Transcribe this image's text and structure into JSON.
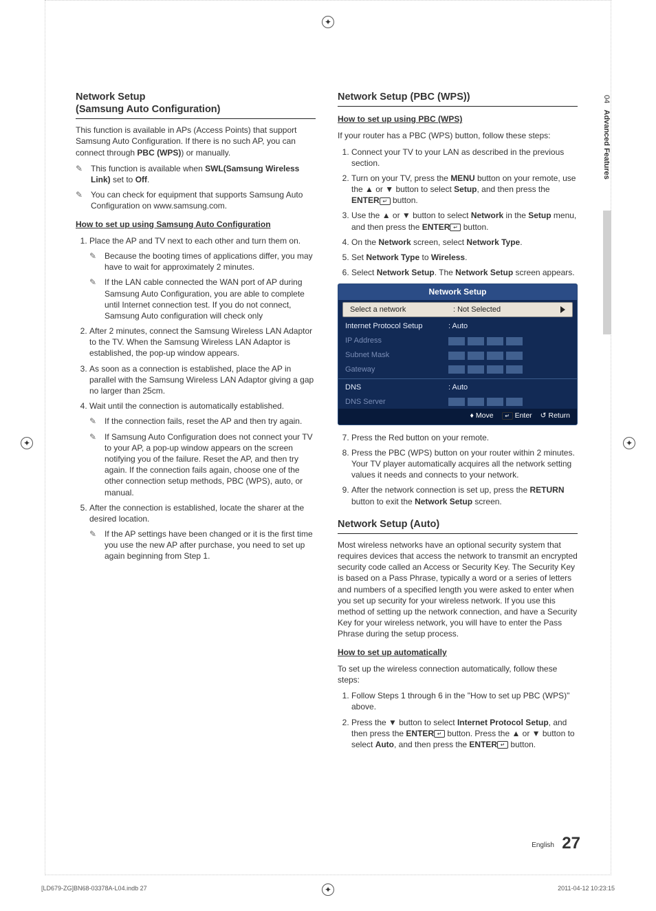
{
  "side_tab": {
    "num": "04",
    "label": "Advanced Features"
  },
  "left": {
    "h": "Network Setup\n(Samsung Auto Configuration)",
    "intro": "This function is available in APs (Access Points) that support Samsung Auto Configuration. If there is no such AP, you can connect through PBC (WPS) or manually.",
    "intro_bold1": "PBC (WPS)",
    "note1_pre": "This function is available when ",
    "note1_bold": "SWL(Samsung Wireless Link)",
    "note1_post": " set to ",
    "note1_off": "Off",
    "note2": "You can check for equipment that supports Samsung Auto Configuration on www.samsung.com.",
    "subh": "How to set up using Samsung Auto Configuration",
    "s1": "Place the AP and TV next to each other and turn them on.",
    "s1n1": "Because the booting times of applications differ, you may have to wait for approximately 2 minutes.",
    "s1n2": "If the LAN cable connected the WAN port of AP during Samsung Auto Configuration, you are able to complete until Internet connection test. If you do not connect, Samsung Auto configuration will check only",
    "s2": "After 2 minutes, connect the Samsung Wireless LAN Adaptor to the TV. When the Samsung Wireless LAN Adaptor is established, the pop-up window appears.",
    "s3": "As soon as a connection is established, place the AP in parallel with the Samsung Wireless LAN Adaptor giving a gap no larger than 25cm.",
    "s4": "Wait until the connection is automatically established.",
    "s4n1": "If the connection fails, reset the AP and then try again.",
    "s4n2": "If Samsung Auto Configuration does not connect your TV to your AP, a pop-up window appears on the screen notifying you of the failure. Reset the AP, and then try again. If the connection fails again, choose one of the other connection setup methods, PBC (WPS), auto, or manual.",
    "s5": "After the connection is established, locate the sharer at the desired location.",
    "s5n1": "If the AP settings have been changed or it is the first time you use the new AP after purchase, you need to set up again beginning from Step 1."
  },
  "right_a": {
    "h": "Network Setup (PBC (WPS))",
    "subh": "How to set up using PBC (WPS)",
    "intro": "If your router has a PBC (WPS) button, follow these steps:",
    "s1": "Connect your TV to your LAN as described in the previous section.",
    "s2_a": "Turn on your TV, press the ",
    "s2_menu": "MENU",
    "s2_b": " button on your remote, use the ▲ or ▼ button to select ",
    "s2_setup": "Setup",
    "s2_c": ", and then press the ",
    "s2_enter": "ENTER",
    "s2_d": " button.",
    "s3_a": "Use the ▲ or ▼ button to select ",
    "s3_net": "Network",
    "s3_b": " in the ",
    "s3_setup": "Setup",
    "s3_c": " menu, and then press the ",
    "s3_enter": "ENTER",
    "s3_d": " button.",
    "s4_a": "On the ",
    "s4_net": "Network",
    "s4_b": " screen, select ",
    "s4_nt": "Network Type",
    "s4_c": ".",
    "s5_a": "Set ",
    "s5_nt": "Network Type",
    "s5_b": " to ",
    "s5_w": "Wireless",
    "s5_c": ".",
    "s6_a": "Select ",
    "s6_ns": "Network Setup",
    "s6_b": ". The ",
    "s6_ns2": "Network Setup",
    "s6_c": " screen appears.",
    "panel": {
      "title": "Network Setup",
      "row_sel_lab": "Select a network",
      "row_sel_val": ": Not Selected",
      "row_ips_lab": "Internet Protocol Setup",
      "row_ips_val": ": Auto",
      "row_ip": "IP Address",
      "row_sn": "Subnet Mask",
      "row_gw": "Gateway",
      "row_dns_lab": "DNS",
      "row_dns_val": ": Auto",
      "row_ds": "DNS Server",
      "f_move": "Move",
      "f_enter": "Enter",
      "f_return": "Return"
    },
    "s7": "Press the Red button on your remote.",
    "s8": "Press the PBC (WPS) button on your router within 2 minutes. Your TV player automatically acquires all the network setting values it needs and connects to your network.",
    "s9_a": "After the network connection is set up, press the ",
    "s9_ret": "RETURN",
    "s9_b": " button to exit the ",
    "s9_ns": "Network Setup",
    "s9_c": " screen."
  },
  "right_b": {
    "h": "Network Setup (Auto)",
    "intro": "Most wireless networks have an optional security system that requires devices that access the network to transmit an encrypted security code called an Access or Security Key. The Security Key is based on a Pass Phrase, typically a word or a series of letters and numbers of a specified length you were asked to enter when you set up security for your wireless network. If you use this method of setting up the network connection, and have a Security Key for your wireless network, you will have to enter the Pass Phrase during the setup process.",
    "subh": "How to set up automatically",
    "lead": "To set up the wireless connection automatically, follow these steps:",
    "s1": "Follow Steps 1 through 6 in the \"How to set up PBC (WPS)\" above.",
    "s2_a": "Press the ▼ button to select ",
    "s2_ips": "Internet Protocol Setup",
    "s2_b": ", and then press the ",
    "s2_enter": "ENTER",
    "s2_c": " button. Press the ▲ or ▼ button to select ",
    "s2_auto": "Auto",
    "s2_d": ", and then press the ",
    "s2_enter2": "ENTER",
    "s2_e": " button."
  },
  "pagefoot": {
    "lang": "English",
    "num": "27"
  },
  "footer": {
    "left": "[LD679-ZG]BN68-03378A-L04.indb   27",
    "right": "2011-04-12     10:23:15"
  }
}
